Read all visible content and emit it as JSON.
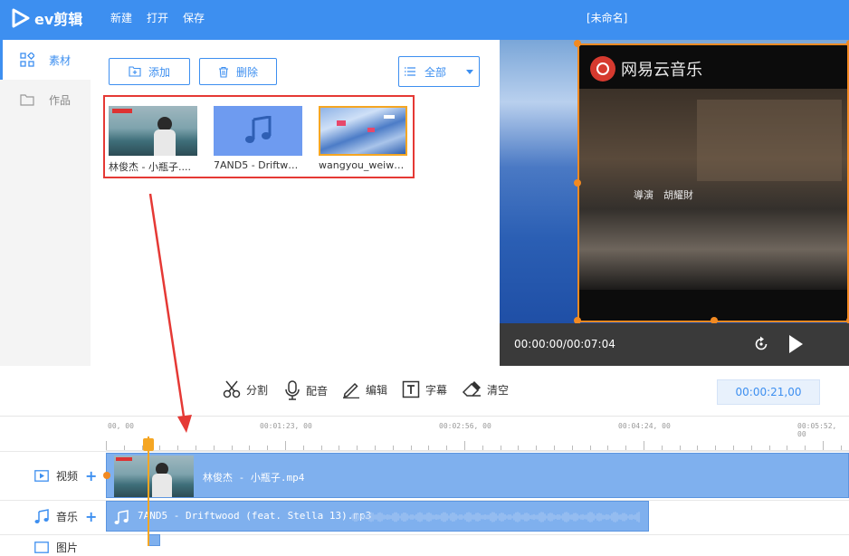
{
  "app": {
    "logo_text": "ev剪辑",
    "menu": [
      "新建",
      "打开",
      "保存"
    ],
    "doc_title": "[未命名]"
  },
  "sidebar": {
    "items": [
      {
        "label": "素材",
        "icon": "grid-icon",
        "active": true
      },
      {
        "label": "作品",
        "icon": "folder-icon",
        "active": false
      }
    ]
  },
  "materials": {
    "add_label": "添加",
    "delete_label": "删除",
    "filter_label": "全部",
    "items": [
      {
        "label": "林俊杰 - 小瓶子....",
        "type": "video"
      },
      {
        "label": "7AND5 - Driftwo...",
        "type": "audio"
      },
      {
        "label": "wangyou_weiwe...",
        "type": "image"
      }
    ]
  },
  "preview": {
    "watermark": "网易云音乐",
    "subtitle": "導演　胡耀財",
    "time": "00:00:00/00:07:04"
  },
  "toolbar": {
    "split": "分割",
    "dub": "配音",
    "edit": "编辑",
    "caption": "字幕",
    "clear": "清空",
    "timecode": "00:00:21,00"
  },
  "timeline": {
    "ruler": [
      "00, 00",
      "00:01:23, 00",
      "00:02:56, 00",
      "00:04:24, 00",
      "00:05:52, 00"
    ],
    "tracks": [
      {
        "label": "视频",
        "clip": "林俊杰 - 小瓶子.mp4"
      },
      {
        "label": "音乐",
        "clip": "7AND5 - Driftwood (feat. Stella 13).mp3"
      },
      {
        "label": "图片"
      }
    ]
  },
  "colors": {
    "accent": "#3d8ff0",
    "highlight": "#e53935",
    "playhead": "#f5a623",
    "clip": "#7fb0ee"
  }
}
